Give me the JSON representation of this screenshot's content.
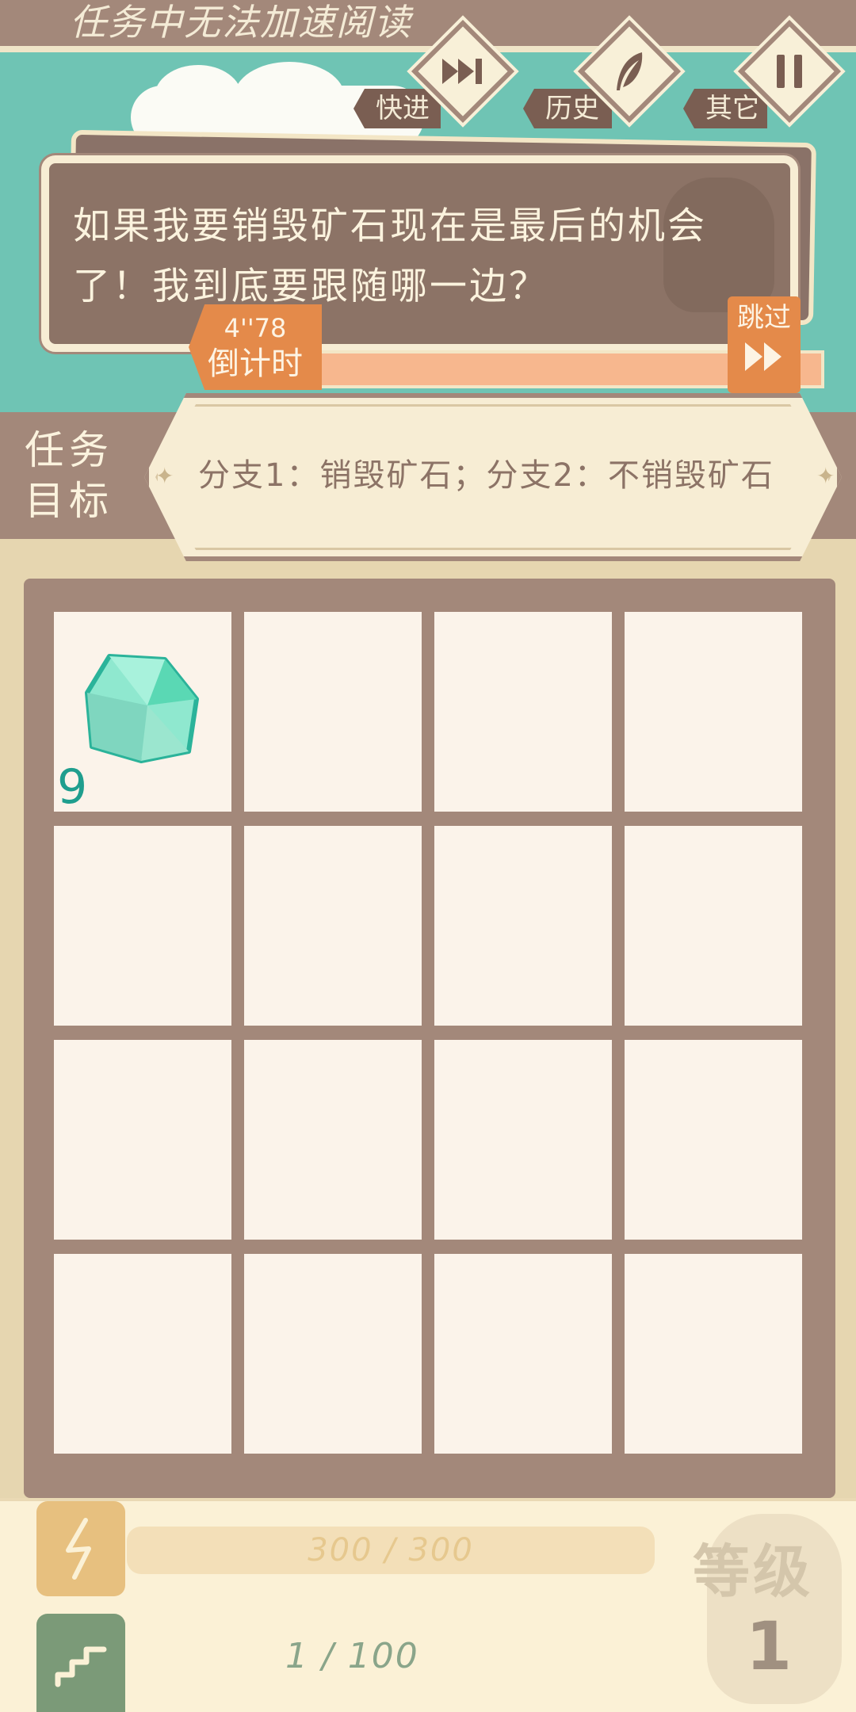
{
  "banner": {
    "text": "任务中无法加速阅读"
  },
  "controls": [
    {
      "label": "快进",
      "icon": "fast-forward-icon"
    },
    {
      "label": "历史",
      "icon": "feather-icon"
    },
    {
      "label": "其它",
      "icon": "pause-icon"
    }
  ],
  "dialog": {
    "text": "如果我要销毁矿石现在是最后的机会了！我到底要跟随哪一边？"
  },
  "timer": {
    "value": "4''78",
    "label": "倒计时"
  },
  "skip": {
    "label": "跳过",
    "icon": "double-arrow-icon"
  },
  "task": {
    "title": "任务目标",
    "text": "分支1：销毁矿石；分支2：不销毁矿石"
  },
  "inventory": {
    "slots": [
      {
        "item": "ore-icon",
        "count": "9"
      },
      {},
      {},
      {},
      {},
      {},
      {},
      {},
      {},
      {},
      {},
      {},
      {},
      {},
      {},
      {}
    ]
  },
  "status": {
    "energy": "300 / 300",
    "energy_icon": "lightning-icon",
    "progress": "1 / 100",
    "progress_icon": "stairs-icon",
    "level_label": "等级",
    "level_value": "1"
  },
  "colors": {
    "teal": "#6fc4b4",
    "brown": "#a3887a",
    "cream": "#f7edd4",
    "orange": "#e48a4a",
    "gem": "#62d6b8"
  }
}
